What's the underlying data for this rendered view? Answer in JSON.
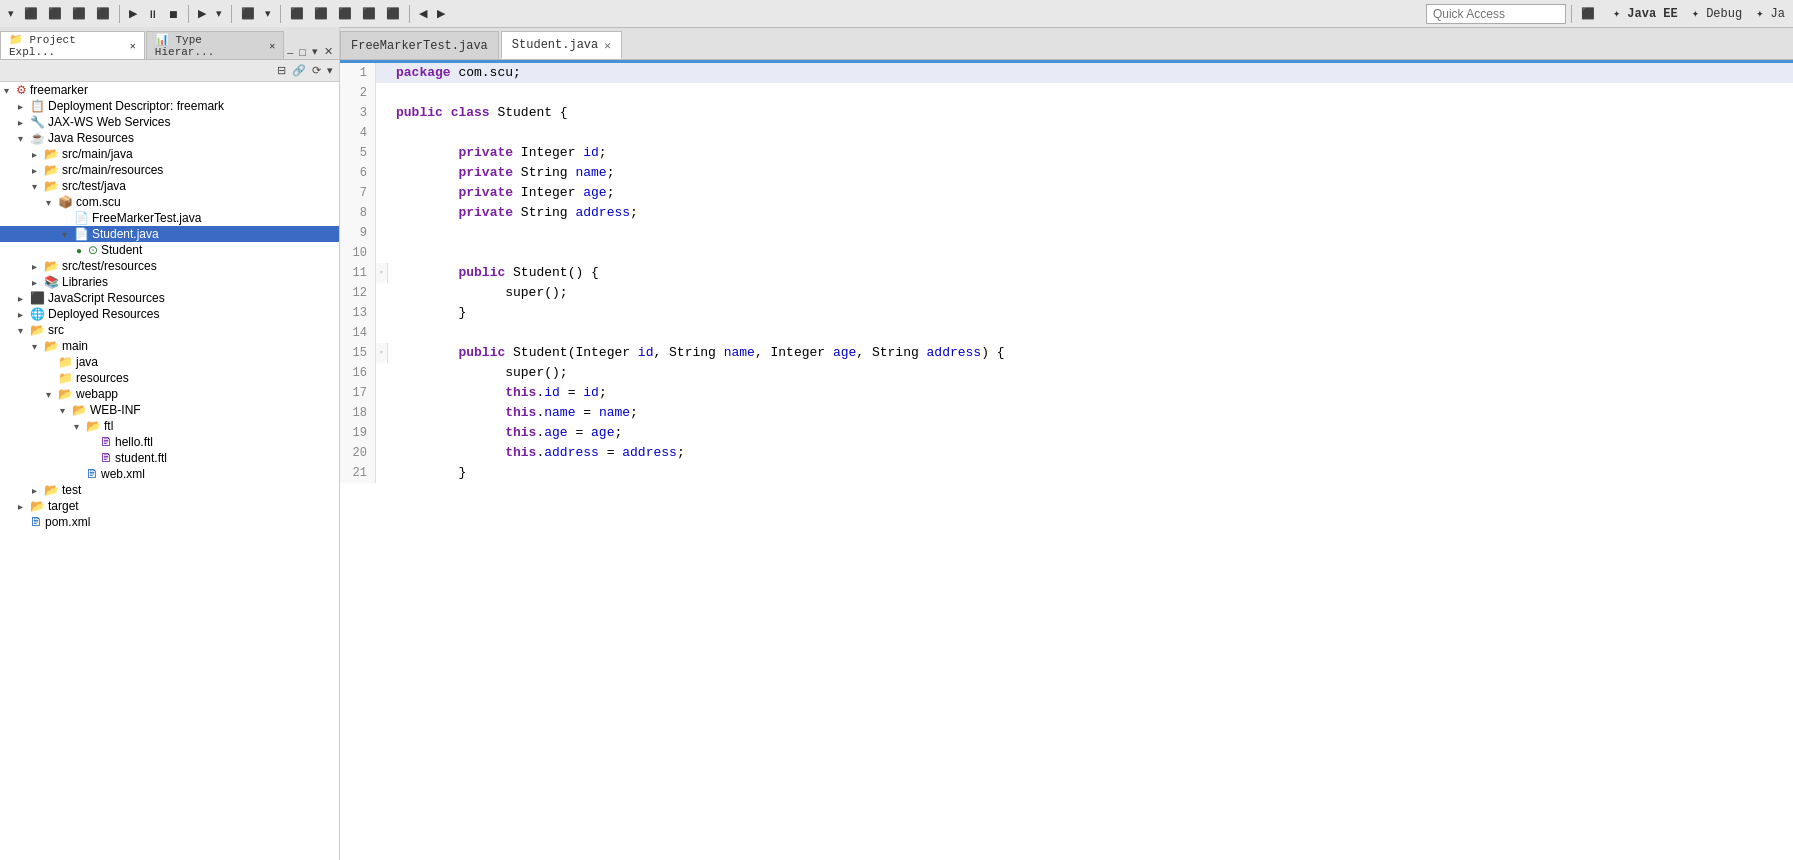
{
  "toolbar": {
    "quick_access_placeholder": "Quick Access",
    "perspective_tabs": [
      "Java EE",
      "Debug",
      "Ja"
    ]
  },
  "sidebar": {
    "tabs": [
      {
        "label": "Project Expl...",
        "active": true
      },
      {
        "label": "Type Hierar...",
        "active": false
      }
    ],
    "tree": [
      {
        "id": "freemarker",
        "label": "freemarker",
        "depth": 0,
        "expanded": true,
        "icon": "project",
        "arrow": "▾"
      },
      {
        "id": "deployment-descriptor",
        "label": "Deployment Descriptor: freemark",
        "depth": 1,
        "expanded": false,
        "icon": "descriptor",
        "arrow": "▸"
      },
      {
        "id": "jax-ws",
        "label": "JAX-WS Web Services",
        "depth": 1,
        "expanded": false,
        "icon": "webservice",
        "arrow": "▸"
      },
      {
        "id": "java-resources",
        "label": "Java Resources",
        "depth": 1,
        "expanded": true,
        "icon": "javares",
        "arrow": "▾"
      },
      {
        "id": "src-main-java",
        "label": "src/main/java",
        "depth": 2,
        "expanded": false,
        "icon": "srcfolder",
        "arrow": "▸"
      },
      {
        "id": "src-main-resources",
        "label": "src/main/resources",
        "depth": 2,
        "expanded": false,
        "icon": "srcfolder",
        "arrow": "▸"
      },
      {
        "id": "src-test-java",
        "label": "src/test/java",
        "depth": 2,
        "expanded": true,
        "icon": "srcfolder",
        "arrow": "▾"
      },
      {
        "id": "com-scu",
        "label": "com.scu",
        "depth": 3,
        "expanded": true,
        "icon": "package",
        "arrow": "▾"
      },
      {
        "id": "FreeMarkerTest",
        "label": "FreeMarkerTest.java",
        "depth": 4,
        "expanded": false,
        "icon": "javafile",
        "arrow": ""
      },
      {
        "id": "Student-java",
        "label": "Student.java",
        "depth": 4,
        "expanded": true,
        "icon": "javafile",
        "arrow": "▾",
        "selected": true
      },
      {
        "id": "Student-class",
        "label": "Student",
        "depth": 5,
        "expanded": false,
        "icon": "class",
        "arrow": "◉"
      },
      {
        "id": "src-test-resources",
        "label": "src/test/resources",
        "depth": 2,
        "expanded": false,
        "icon": "srcfolder",
        "arrow": "▸"
      },
      {
        "id": "Libraries",
        "label": "Libraries",
        "depth": 2,
        "expanded": false,
        "icon": "library",
        "arrow": "▸"
      },
      {
        "id": "JavaScript-Resources",
        "label": "JavaScript Resources",
        "depth": 1,
        "expanded": false,
        "icon": "jsres",
        "arrow": "▸"
      },
      {
        "id": "Deployed-Resources",
        "label": "Deployed Resources",
        "depth": 1,
        "expanded": false,
        "icon": "deployed",
        "arrow": "▸"
      },
      {
        "id": "src",
        "label": "src",
        "depth": 1,
        "expanded": true,
        "icon": "srcfolder2",
        "arrow": "▾"
      },
      {
        "id": "main",
        "label": "main",
        "depth": 2,
        "expanded": true,
        "icon": "folder",
        "arrow": "▾"
      },
      {
        "id": "java",
        "label": "java",
        "depth": 3,
        "expanded": false,
        "icon": "folder",
        "arrow": ""
      },
      {
        "id": "resources",
        "label": "resources",
        "depth": 3,
        "expanded": false,
        "icon": "folder",
        "arrow": ""
      },
      {
        "id": "webapp",
        "label": "webapp",
        "depth": 3,
        "expanded": true,
        "icon": "folder",
        "arrow": "▾"
      },
      {
        "id": "WEB-INF",
        "label": "WEB-INF",
        "depth": 4,
        "expanded": true,
        "icon": "webinf",
        "arrow": "▾"
      },
      {
        "id": "ftl",
        "label": "ftl",
        "depth": 5,
        "expanded": true,
        "icon": "folder",
        "arrow": "▾"
      },
      {
        "id": "hello-ftl",
        "label": "hello.ftl",
        "depth": 6,
        "expanded": false,
        "icon": "ftlfile",
        "arrow": ""
      },
      {
        "id": "student-ftl",
        "label": "student.ftl",
        "depth": 6,
        "expanded": false,
        "icon": "ftlfile",
        "arrow": ""
      },
      {
        "id": "web-xml",
        "label": "web.xml",
        "depth": 5,
        "expanded": false,
        "icon": "xml",
        "arrow": ""
      },
      {
        "id": "test",
        "label": "test",
        "depth": 2,
        "expanded": false,
        "icon": "folder",
        "arrow": "▸"
      },
      {
        "id": "target",
        "label": "target",
        "depth": 1,
        "expanded": false,
        "icon": "folder",
        "arrow": "▸"
      },
      {
        "id": "pom-xml",
        "label": "pom.xml",
        "depth": 1,
        "expanded": false,
        "icon": "xml",
        "arrow": ""
      }
    ]
  },
  "editor": {
    "tabs": [
      {
        "label": "FreeMarkerTest.java",
        "active": false,
        "closeable": false
      },
      {
        "label": "Student.java",
        "active": true,
        "closeable": true
      }
    ],
    "lines": [
      {
        "num": 1,
        "content": "package com.scu;",
        "tokens": [
          {
            "t": "kw",
            "v": "package"
          },
          {
            "t": "",
            "v": " com.scu;"
          }
        ],
        "gutter": ""
      },
      {
        "num": 2,
        "content": "",
        "tokens": [],
        "gutter": ""
      },
      {
        "num": 3,
        "content": "public class Student {",
        "tokens": [
          {
            "t": "kw",
            "v": "public"
          },
          {
            "t": "",
            "v": " "
          },
          {
            "t": "kw",
            "v": "class"
          },
          {
            "t": "",
            "v": " Student {"
          }
        ],
        "gutter": ""
      },
      {
        "num": 4,
        "content": "",
        "tokens": [],
        "gutter": ""
      },
      {
        "num": 5,
        "content": "    private Integer id;",
        "tokens": [
          {
            "t": "sp",
            "v": "    "
          },
          {
            "t": "kw",
            "v": "private"
          },
          {
            "t": "",
            "v": " Integer "
          },
          {
            "t": "var",
            "v": "id"
          },
          {
            "t": "",
            "v": ";"
          }
        ],
        "gutter": ""
      },
      {
        "num": 6,
        "content": "    private String name;",
        "tokens": [
          {
            "t": "sp",
            "v": "    "
          },
          {
            "t": "kw",
            "v": "private"
          },
          {
            "t": "",
            "v": " String "
          },
          {
            "t": "var",
            "v": "name"
          },
          {
            "t": "",
            "v": ";"
          }
        ],
        "gutter": ""
      },
      {
        "num": 7,
        "content": "    private Integer age;",
        "tokens": [
          {
            "t": "sp",
            "v": "    "
          },
          {
            "t": "kw",
            "v": "private"
          },
          {
            "t": "",
            "v": " Integer "
          },
          {
            "t": "var",
            "v": "age"
          },
          {
            "t": "",
            "v": ";"
          }
        ],
        "gutter": ""
      },
      {
        "num": 8,
        "content": "    private String address;",
        "tokens": [
          {
            "t": "sp",
            "v": "    "
          },
          {
            "t": "kw",
            "v": "private"
          },
          {
            "t": "",
            "v": " String "
          },
          {
            "t": "var",
            "v": "address"
          },
          {
            "t": "",
            "v": ";"
          }
        ],
        "gutter": ""
      },
      {
        "num": 9,
        "content": "",
        "tokens": [],
        "gutter": ""
      },
      {
        "num": 10,
        "content": "",
        "tokens": [],
        "gutter": ""
      },
      {
        "num": 11,
        "content": "    public Student() {",
        "tokens": [
          {
            "t": "sp",
            "v": "    "
          },
          {
            "t": "kw",
            "v": "public"
          },
          {
            "t": "",
            "v": " Student() {"
          }
        ],
        "gutter": "◦"
      },
      {
        "num": 12,
        "content": "        super();",
        "tokens": [
          {
            "t": "sp",
            "v": "        "
          },
          {
            "t": "",
            "v": "super();"
          }
        ],
        "gutter": ""
      },
      {
        "num": 13,
        "content": "    }",
        "tokens": [
          {
            "t": "sp",
            "v": "    "
          },
          {
            "t": "",
            "v": "}"
          }
        ],
        "gutter": ""
      },
      {
        "num": 14,
        "content": "",
        "tokens": [],
        "gutter": ""
      },
      {
        "num": 15,
        "content": "    public Student(Integer id, String name, Integer age, String address) {",
        "tokens": [
          {
            "t": "sp",
            "v": "    "
          },
          {
            "t": "kw",
            "v": "public"
          },
          {
            "t": "",
            "v": " Student(Integer "
          },
          {
            "t": "var",
            "v": "id"
          },
          {
            "t": "",
            "v": ", String "
          },
          {
            "t": "var",
            "v": "name"
          },
          {
            "t": "",
            "v": ", Integer "
          },
          {
            "t": "var",
            "v": "age"
          },
          {
            "t": "",
            "v": ", String "
          },
          {
            "t": "var",
            "v": "address"
          },
          {
            "t": "",
            "v": ") {"
          }
        ],
        "gutter": "◦"
      },
      {
        "num": 16,
        "content": "        super();",
        "tokens": [
          {
            "t": "sp",
            "v": "        "
          },
          {
            "t": "",
            "v": "super();"
          }
        ],
        "gutter": ""
      },
      {
        "num": 17,
        "content": "        this.id = id;",
        "tokens": [
          {
            "t": "sp",
            "v": "        "
          },
          {
            "t": "kw",
            "v": "this"
          },
          {
            "t": "",
            "v": "."
          },
          {
            "t": "var",
            "v": "id"
          },
          {
            "t": "",
            "v": " = "
          },
          {
            "t": "var",
            "v": "id"
          },
          {
            "t": "",
            "v": ";"
          }
        ],
        "gutter": ""
      },
      {
        "num": 18,
        "content": "        this.name = name;",
        "tokens": [
          {
            "t": "sp",
            "v": "        "
          },
          {
            "t": "kw",
            "v": "this"
          },
          {
            "t": "",
            "v": "."
          },
          {
            "t": "var",
            "v": "name"
          },
          {
            "t": "",
            "v": " = "
          },
          {
            "t": "var",
            "v": "name"
          },
          {
            "t": "",
            "v": ";"
          }
        ],
        "gutter": ""
      },
      {
        "num": 19,
        "content": "        this.age = age;",
        "tokens": [
          {
            "t": "sp",
            "v": "        "
          },
          {
            "t": "kw",
            "v": "this"
          },
          {
            "t": "",
            "v": "."
          },
          {
            "t": "var",
            "v": "age"
          },
          {
            "t": "",
            "v": " = "
          },
          {
            "t": "var",
            "v": "age"
          },
          {
            "t": "",
            "v": ";"
          }
        ],
        "gutter": ""
      },
      {
        "num": 20,
        "content": "        this.address = address;",
        "tokens": [
          {
            "t": "sp",
            "v": "        "
          },
          {
            "t": "kw",
            "v": "this"
          },
          {
            "t": "",
            "v": "."
          },
          {
            "t": "var",
            "v": "address"
          },
          {
            "t": "",
            "v": " = "
          },
          {
            "t": "var",
            "v": "address"
          },
          {
            "t": "",
            "v": ";"
          }
        ],
        "gutter": ""
      },
      {
        "num": 21,
        "content": "    }",
        "tokens": [
          {
            "t": "sp",
            "v": "    "
          },
          {
            "t": "",
            "v": "}"
          }
        ],
        "gutter": ""
      }
    ]
  }
}
